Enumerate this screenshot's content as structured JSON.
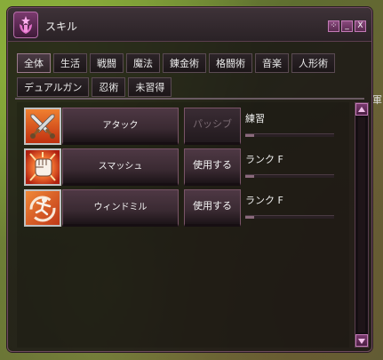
{
  "window": {
    "title": "スキル",
    "buttons": [
      "⁘",
      "_",
      "X"
    ]
  },
  "background": {
    "edge_text": "軍"
  },
  "tabs": {
    "row1": [
      "全体",
      "生活",
      "戦闘",
      "魔法",
      "錬金術",
      "格闘術",
      "音楽",
      "人形術"
    ],
    "row2": [
      "デュアルガン",
      "忍術",
      "未習得"
    ],
    "active": "全体"
  },
  "skills": [
    {
      "name": "アタック",
      "action": "パッシブ",
      "action_enabled": false,
      "rank": "練習",
      "icon": "crossed-swords-icon",
      "progress": 0.1
    },
    {
      "name": "スマッシュ",
      "action": "使用する",
      "action_enabled": true,
      "rank": "ランク F",
      "icon": "fist-icon",
      "progress": 0.1
    },
    {
      "name": "ウィンドミル",
      "action": "使用する",
      "action_enabled": true,
      "rank": "ランク F",
      "icon": "windmill-icon",
      "progress": 0.1
    }
  ],
  "colors": {
    "accent": "#b56ea8",
    "panel": "#161214",
    "button": "#3a2a32"
  }
}
